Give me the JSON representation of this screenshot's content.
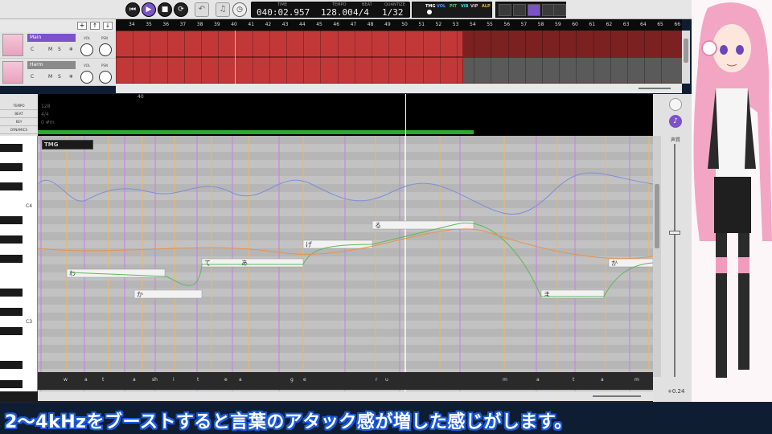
{
  "transport": {
    "time_label": "TIME",
    "time_value": "040:02.957",
    "tempo_label": "TEMPO",
    "tempo_value": "128.00",
    "beat_label": "BEAT",
    "beat_value": "4/4",
    "quantize_label": "QUANTIZE",
    "quantize_value": "1/32"
  },
  "modes": [
    "TMG",
    "VOL",
    "PIT",
    "VIB",
    "VIP",
    "ALP"
  ],
  "tracks": [
    {
      "name": "Main",
      "c": "C",
      "m": "M",
      "s": "S",
      "vol": "VOL",
      "psn": "PSN"
    },
    {
      "name": "Harm",
      "c": "C",
      "m": "M",
      "s": "S",
      "vol": "VOL",
      "psn": "PSN"
    }
  ],
  "ruler_bars": [
    "34",
    "35",
    "36",
    "37",
    "38",
    "39",
    "40",
    "41",
    "42",
    "43",
    "44",
    "45",
    "46",
    "47",
    "48",
    "49",
    "50",
    "51",
    "52",
    "53",
    "54",
    "55",
    "56",
    "57",
    "58",
    "59",
    "60",
    "61",
    "62",
    "63",
    "64",
    "65",
    "66"
  ],
  "editor": {
    "bar_marker": "40",
    "lanes": [
      "TEMPO",
      "BEAT",
      "KEY",
      "DYNAMICS"
    ],
    "lane_values": {
      "tempo": "128",
      "beat": "4/4",
      "key": "0 #m"
    },
    "piano_labels": [
      "C4",
      "C3"
    ],
    "tmg_label": "TMG",
    "notes": [
      {
        "lyric": "わ"
      },
      {
        "lyric": "か"
      },
      {
        "lyric": "て"
      },
      {
        "lyric": "あ"
      },
      {
        "lyric": "げ"
      },
      {
        "lyric": "る"
      },
      {
        "lyric": "ま"
      },
      {
        "lyric": "か"
      }
    ],
    "phonemes": [
      "w",
      "a",
      "t",
      "a",
      "sh",
      "i",
      "t",
      "e",
      "a",
      "g",
      "e",
      "r",
      "u",
      "m",
      "a",
      "t",
      "a",
      "m"
    ]
  },
  "right_panel": {
    "voice_label": "声質",
    "value": "+0.24"
  },
  "subtitle": "2〜4kHzをブーストすると言葉のアタック感が増した感じがします。",
  "colors": {
    "accent": "#7b52c9",
    "track_red": "#c23838",
    "playhead": "#ffffff",
    "subtitle_outline": "#1b5ad9"
  }
}
